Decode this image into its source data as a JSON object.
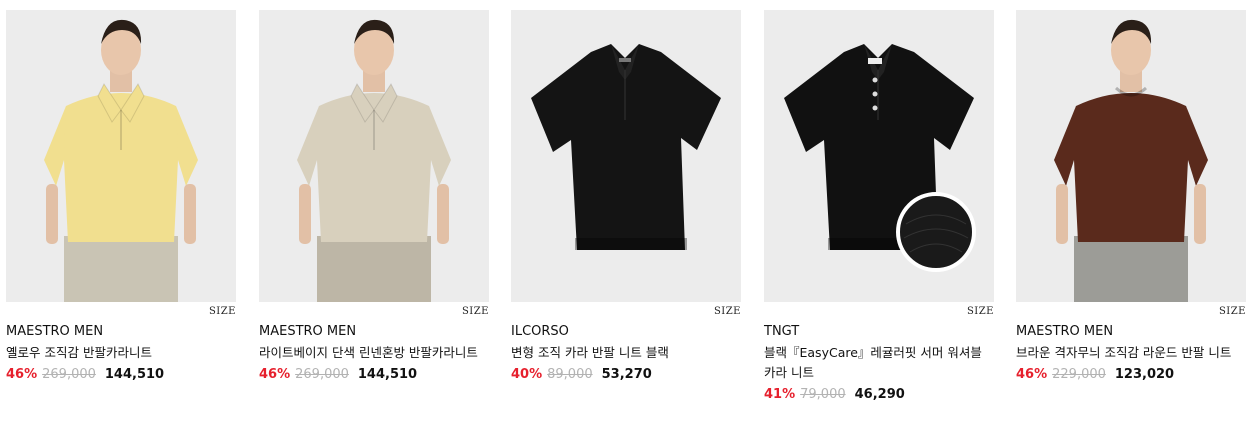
{
  "size_label": "SIZE",
  "products": [
    {
      "brand": "MAESTRO MEN",
      "name": "옐로우 조직감 반팔카라니트",
      "discount": "46%",
      "original_price": "269,000",
      "sale_price": "144,510",
      "garment_color": "#f1df8f",
      "pants_color": "#c9c4b4",
      "style": "model-polo"
    },
    {
      "brand": "MAESTRO MEN",
      "name": "라이트베이지 단색 린넨혼방 반팔카라니트",
      "discount": "46%",
      "original_price": "269,000",
      "sale_price": "144,510",
      "garment_color": "#d8d0bd",
      "pants_color": "#bdb6a6",
      "style": "model-polo"
    },
    {
      "brand": "ILCORSO",
      "name": "변형 조직 카라 반팔 니트 블랙",
      "discount": "40%",
      "original_price": "89,000",
      "sale_price": "53,270",
      "garment_color": "#141414",
      "style": "flat-polo"
    },
    {
      "brand": "TNGT",
      "name": "블랙『EasyCare』레귤러핏 서머 워셔블 카라 니트",
      "discount": "41%",
      "original_price": "79,000",
      "sale_price": "46,290",
      "garment_color": "#111111",
      "style": "flat-polo-detail"
    },
    {
      "brand": "MAESTRO MEN",
      "name": "브라운 격자무늬 조직감 라운드 반팔 니트",
      "discount": "46%",
      "original_price": "229,000",
      "sale_price": "123,020",
      "garment_color": "#5a2a1c",
      "pants_color": "#9c9c97",
      "style": "model-crew"
    }
  ]
}
